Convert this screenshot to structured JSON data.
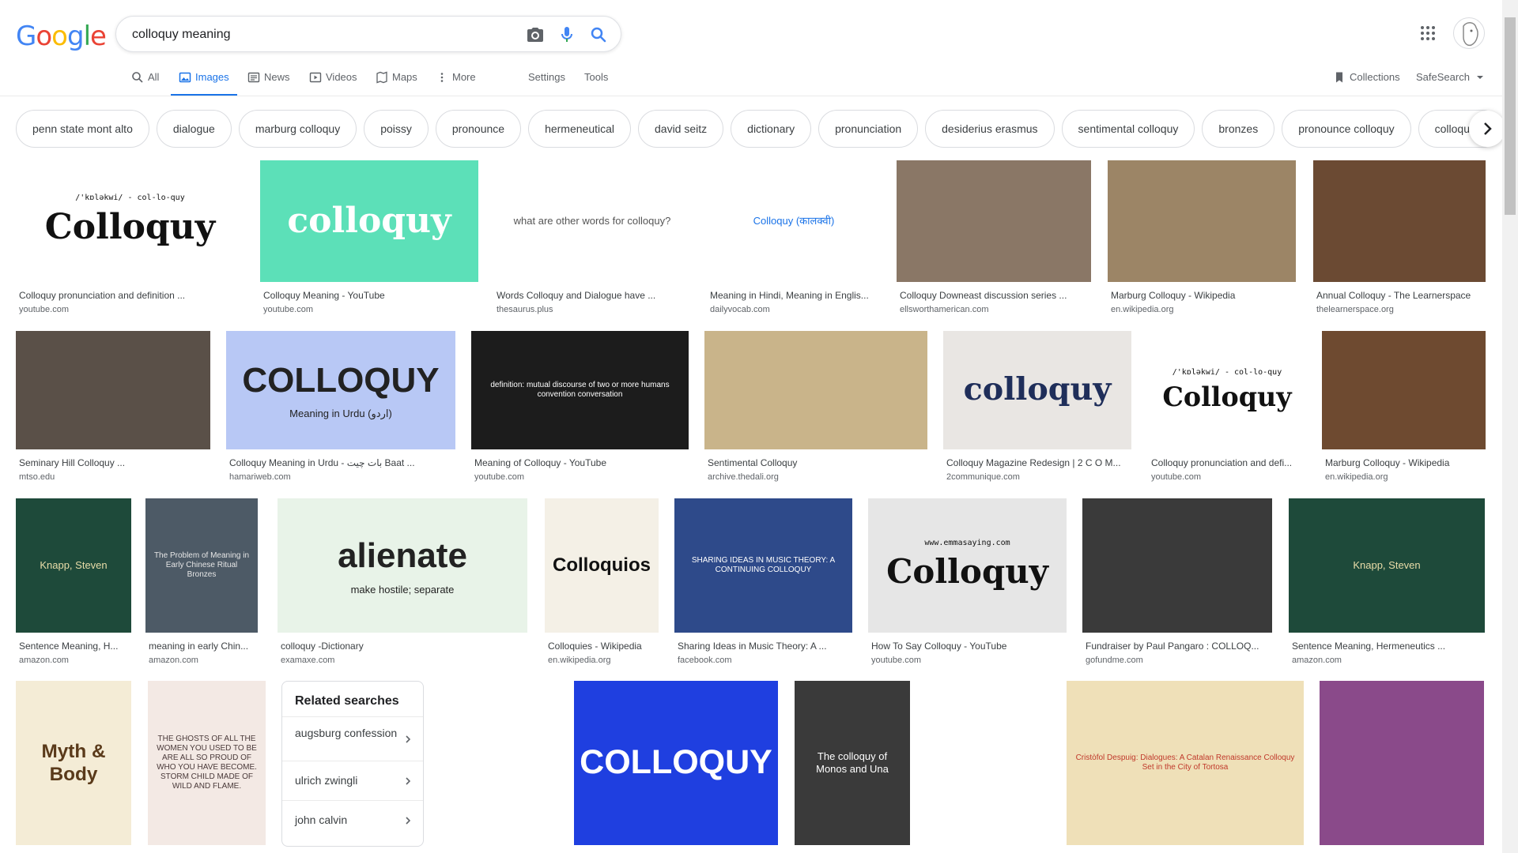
{
  "logo": {
    "letters": [
      "G",
      "o",
      "o",
      "g",
      "l",
      "e"
    ],
    "colors": [
      "#4285F4",
      "#EA4335",
      "#FBBC05",
      "#4285F4",
      "#34A853",
      "#EA4335"
    ]
  },
  "search": {
    "value": "colloquy meaning",
    "placeholder": ""
  },
  "tabs": [
    {
      "label": "All",
      "icon": "search-icon"
    },
    {
      "label": "Images",
      "icon": "image-icon",
      "active": true
    },
    {
      "label": "News",
      "icon": "news-icon"
    },
    {
      "label": "Videos",
      "icon": "video-icon"
    },
    {
      "label": "Maps",
      "icon": "map-icon"
    },
    {
      "label": "More",
      "icon": "more-vert-icon"
    },
    {
      "label": "Settings"
    },
    {
      "label": "Tools"
    }
  ],
  "right_tools": {
    "collections": "Collections",
    "safesearch": "SafeSearch"
  },
  "chips": [
    "penn state mont alto",
    "dialogue",
    "marburg colloquy",
    "poissy",
    "pronounce",
    "hermeneutical",
    "david seitz",
    "dictionary",
    "pronunciation",
    "desiderius erasmus",
    "sentimental colloquy",
    "bronzes",
    "pronounce colloquy",
    "colloquy d"
  ],
  "row1": [
    {
      "caption": "Colloquy pronunciation and definition ...",
      "source": "youtube.com",
      "thumb_text": "Colloquy",
      "thumb_sub": "/'kɒləkwi/ - col-lo-quy",
      "bg": "#ffffff",
      "fg": "#111111"
    },
    {
      "caption": "Colloquy Meaning - YouTube",
      "source": "youtube.com",
      "thumb_text": "colloquy",
      "bg": "#5ce0b8",
      "fg": "#ffffff"
    },
    {
      "caption": "Words Colloquy and Dialogue have ...",
      "source": "thesaurus.plus",
      "thumb_text": "what are other words for colloquy?",
      "bg": "#ffffff",
      "fg": "#555555"
    },
    {
      "caption": "Meaning in Hindi, Meaning in Englis...",
      "source": "dailyvocab.com",
      "thumb_text": "Colloquy (कालक्वी)",
      "bg": "#ffffff",
      "fg": "#1a73e8"
    },
    {
      "caption": "Colloquy Downeast discussion series ...",
      "source": "ellsworthamerican.com",
      "thumb_text": "",
      "bg": "#8a7766",
      "fg": "#ffffff"
    },
    {
      "caption": "Marburg Colloquy - Wikipedia",
      "source": "en.wikipedia.org",
      "thumb_text": "",
      "bg": "#9c8566",
      "fg": "#ffffff"
    },
    {
      "caption": "Annual Colloquy - The Learnerspace",
      "source": "thelearnerspace.org",
      "thumb_text": "",
      "bg": "#6b4a33",
      "fg": "#ffffff"
    }
  ],
  "row2": [
    {
      "caption": "Seminary Hill Colloquy ...",
      "source": "mtso.edu",
      "thumb_text": "",
      "bg": "#5a5048",
      "fg": "#ffffff"
    },
    {
      "caption": "Colloquy Meaning in Urdu - بات چیت Baat ...",
      "source": "hamariweb.com",
      "thumb_text": "COLLOQUY",
      "thumb_sub": "Meaning in Urdu (اردو)",
      "bg": "#b8c8f5",
      "fg": "#222222"
    },
    {
      "caption": "Meaning of Colloquy - YouTube",
      "source": "youtube.com",
      "thumb_text": "definition: mutual discourse of two or more humans convention conversation",
      "bg": "#1c1c1c",
      "fg": "#ffffff"
    },
    {
      "caption": "Sentimental Colloquy",
      "source": "archive.thedali.org",
      "thumb_text": "",
      "bg": "#c9b48a",
      "fg": "#333333"
    },
    {
      "caption": "Colloquy Magazine Redesign | 2 C O M...",
      "source": "2communique.com",
      "thumb_text": "colloquy",
      "bg": "#e9e6e3",
      "fg": "#1f2e5a"
    },
    {
      "caption": "Colloquy pronunciation and defi...",
      "source": "youtube.com",
      "thumb_text": "Colloquy",
      "thumb_sub": "/'kɒləkwi/ - col-lo-quy",
      "bg": "#ffffff",
      "fg": "#111111"
    },
    {
      "caption": "Marburg Colloquy - Wikipedia",
      "source": "en.wikipedia.org",
      "thumb_text": "",
      "bg": "#6e4a30",
      "fg": "#ffffff"
    }
  ],
  "row3": [
    {
      "caption": "Sentence Meaning, H...",
      "source": "amazon.com",
      "thumb_text": "Knapp, Steven",
      "bg": "#1e4a3a",
      "fg": "#e8dca8"
    },
    {
      "caption": "meaning in early Chin...",
      "source": "amazon.com",
      "thumb_text": "The Problem of Meaning in Early Chinese Ritual Bronzes",
      "bg": "#4d5a66",
      "fg": "#e6e6e6"
    },
    {
      "caption": "colloquy -Dictionary",
      "source": "examaxe.com",
      "thumb_text": "alienate",
      "thumb_sub": "make hostile; separate",
      "bg": "#e8f3e8",
      "fg": "#222222"
    },
    {
      "caption": "Colloquies - Wikipedia",
      "source": "en.wikipedia.org",
      "thumb_text": "Colloquios",
      "bg": "#f4f0e6",
      "fg": "#111111"
    },
    {
      "caption": "Sharing Ideas in Music Theory: A ...",
      "source": "facebook.com",
      "thumb_text": "SHARING IDEAS IN MUSIC THEORY: A CONTINUING COLLOQUY",
      "bg": "#2e4a8a",
      "fg": "#ffffff"
    },
    {
      "caption": "How To Say Colloquy - YouTube",
      "source": "youtube.com",
      "thumb_text": "Colloquy",
      "thumb_sub": "www.emmasaying.com",
      "bg": "#e6e6e6",
      "fg": "#111111"
    },
    {
      "caption": "Fundraiser by Paul Pangaro : COLLOQ...",
      "source": "gofundme.com",
      "thumb_text": "",
      "bg": "#3a3a3a",
      "fg": "#ffffff"
    },
    {
      "caption": "Sentence Meaning, Hermeneutics ...",
      "source": "amazon.com",
      "thumb_text": "Knapp, Steven",
      "bg": "#1e4a3a",
      "fg": "#e8dca8"
    }
  ],
  "row4": [
    {
      "thumb_text": "Myth & Body",
      "bg": "#f4ecd6",
      "fg": "#5a3a1a"
    },
    {
      "thumb_text": "THE GHOSTS OF ALL THE WOMEN YOU USED TO BE ARE ALL SO PROUD OF WHO YOU HAVE BECOME. STORM CHILD MADE OF WILD AND FLAME.",
      "bg": "#f3e9e4",
      "fg": "#4a3a3a"
    },
    {
      "thumb_text": "",
      "bg": "#ffffff",
      "fg": "#333333"
    },
    {
      "thumb_text": "COLLOQUY",
      "bg": "#1f3fe0",
      "fg": "#ffffff"
    },
    {
      "thumb_text": "The colloquy of Monos and Una",
      "bg": "#3a3a3a",
      "fg": "#ffffff"
    },
    {
      "thumb_text": "",
      "bg": "#ffffff",
      "fg": "#333333"
    },
    {
      "thumb_text": "Cristòfol Despuig: Dialogues: A Catalan Renaissance Colloquy Set in the City of Tortosa",
      "bg": "#efe0b8",
      "fg": "#c0392b"
    },
    {
      "thumb_text": "",
      "bg": "#8a4a8a",
      "fg": "#ffffff"
    }
  ],
  "related": {
    "title": "Related searches",
    "items": [
      "augsburg confession",
      "ulrich zwingli",
      "john calvin"
    ]
  }
}
